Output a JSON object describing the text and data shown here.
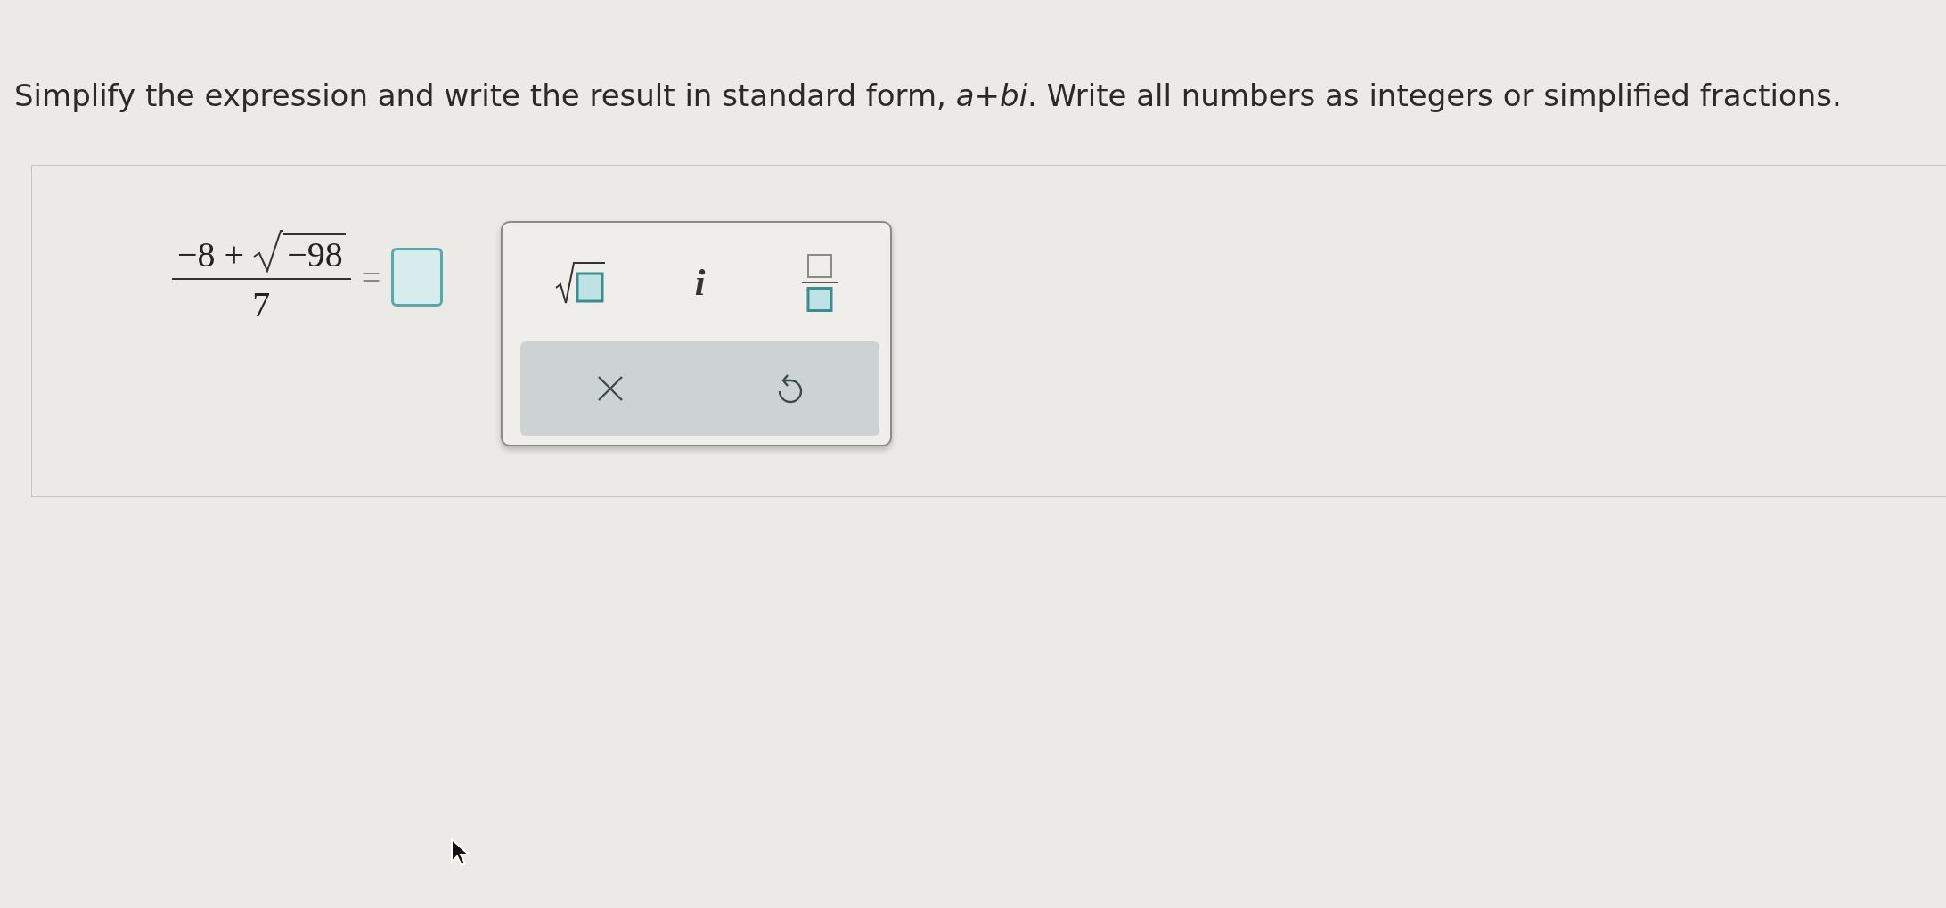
{
  "instruction": "Simplify the expression and write the result in standard form, *a*+*bi*. Write all numbers as integers or simplified fractions.",
  "problem": {
    "numerator": {
      "term": "−8",
      "operator": "+",
      "radicand": "−98"
    },
    "denominator": "7",
    "equals": "="
  },
  "keypad": {
    "templates": [
      {
        "kind": "sqrt"
      },
      {
        "kind": "imaginary",
        "label": "i"
      },
      {
        "kind": "fraction"
      }
    ],
    "actions": [
      {
        "kind": "clear"
      },
      {
        "kind": "undo"
      }
    ]
  }
}
